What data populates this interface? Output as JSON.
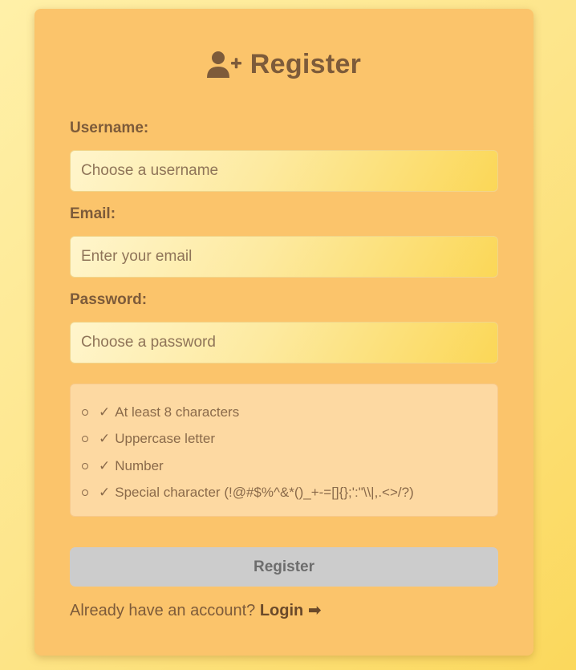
{
  "form": {
    "title": "Register",
    "title_icon": "user-plus-icon",
    "username_label": "Username:",
    "username_placeholder": "Choose a username",
    "email_label": "Email:",
    "email_placeholder": "Enter your email",
    "password_label": "Password:",
    "password_placeholder": "Choose a password",
    "password_rules": [
      {
        "check": "✓",
        "text": "At least 8 characters"
      },
      {
        "check": "✓",
        "text": "Uppercase letter"
      },
      {
        "check": "✓",
        "text": "Number"
      },
      {
        "check": "✓",
        "text": "Special character (!@#$%^&*()_+-=[]{};':\"\\\\|,.<>/?)"
      }
    ],
    "submit_label": "Register",
    "footer_text": "Already have an account?",
    "login_link_label": "Login ➡"
  },
  "colors": {
    "card_bg": "#fbc46b",
    "text": "#7d5b3a",
    "button_disabled": "#cccccc"
  }
}
